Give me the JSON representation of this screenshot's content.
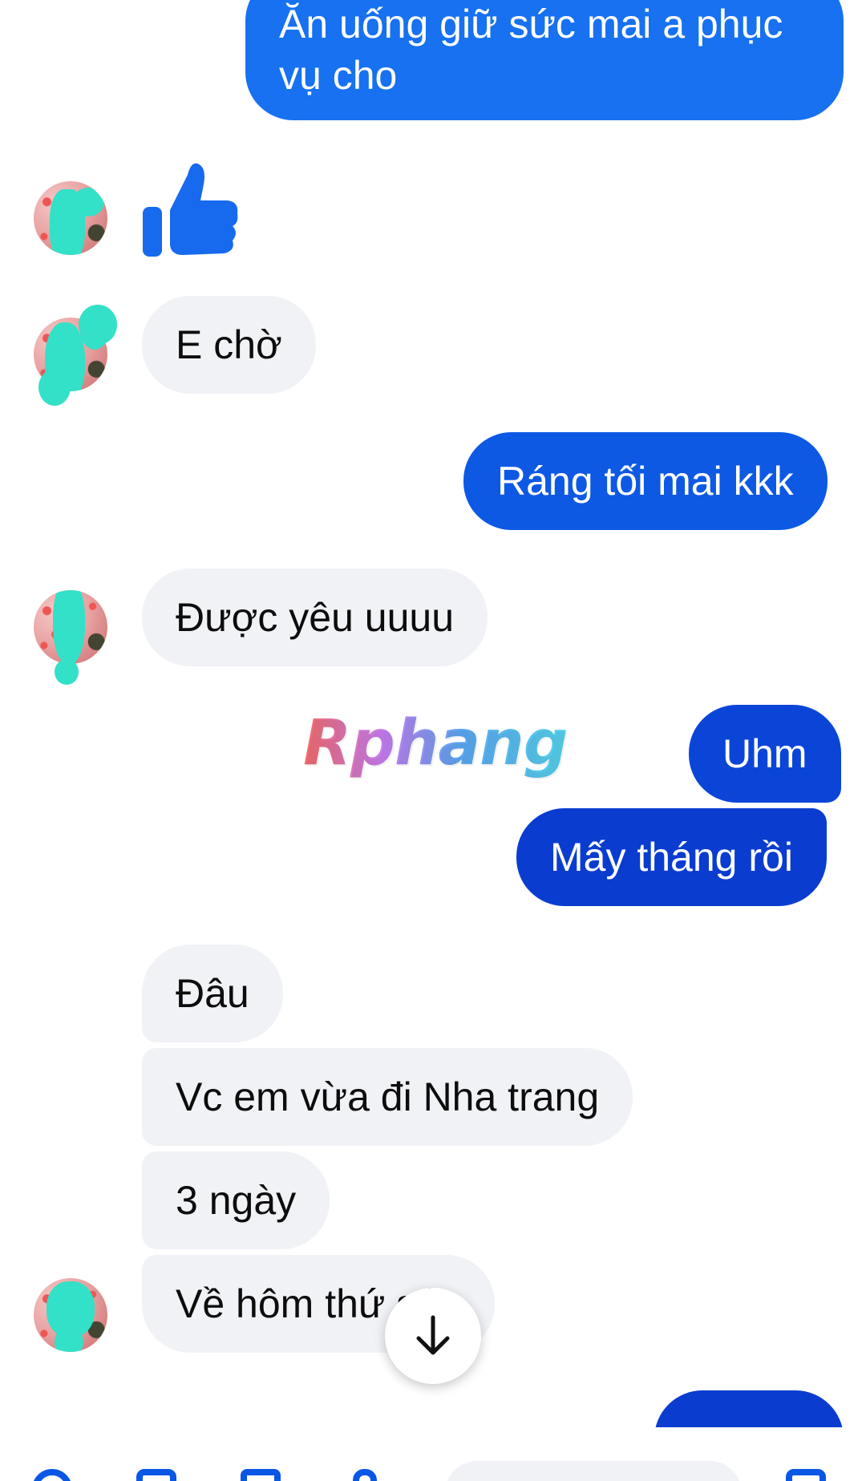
{
  "colors": {
    "sent_top": "#1877f2",
    "sent_mid": "#0f5ce6",
    "sent_bottom": "#0a3cd0",
    "received": "#f1f2f6",
    "teal_blot": "#33e0c8",
    "accent": "#0a57e6"
  },
  "messages": [
    {
      "side": "sent",
      "text": "Ăn uống giữ sức mai a phục vụ cho"
    },
    {
      "side": "received",
      "type": "like",
      "icon": "thumbs-up-icon"
    },
    {
      "side": "received",
      "text": "E chờ"
    },
    {
      "side": "sent",
      "text": "Ráng tối mai kkk"
    },
    {
      "side": "received",
      "text": "Được yêu uuuu"
    },
    {
      "side": "sent",
      "text": "Uhm"
    },
    {
      "side": "sent",
      "text": "Mấy tháng rồi"
    },
    {
      "side": "received",
      "text": "Đâu"
    },
    {
      "side": "received",
      "text": "Vc em vừa đi Nha trang"
    },
    {
      "side": "received",
      "text": "3 ngày"
    },
    {
      "side": "received",
      "text": "Về hôm thứ sáu"
    }
  ],
  "watermark": "Rphang",
  "scroll_button_icon": "arrow-down-icon"
}
